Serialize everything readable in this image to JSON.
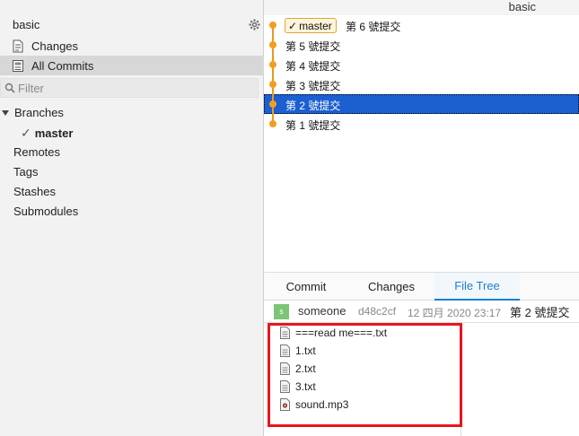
{
  "window": {
    "title": "basic"
  },
  "sidebar": {
    "repo_name": "basic",
    "settings_icon": "gear-icon",
    "nav": [
      {
        "label": "Changes",
        "icon": "changes-icon",
        "active": false
      },
      {
        "label": "All Commits",
        "icon": "commits-icon",
        "active": true
      }
    ],
    "filter": {
      "placeholder": "Filter",
      "value": ""
    },
    "tree": {
      "branches_label": "Branches",
      "current_branch": "master",
      "sections": [
        "Remotes",
        "Tags",
        "Stashes",
        "Submodules"
      ]
    }
  },
  "commits": [
    {
      "branch": "master",
      "message": "第 6 號提交",
      "selected": false
    },
    {
      "message": "第 5 號提交",
      "selected": false
    },
    {
      "message": "第 4 號提交",
      "selected": false
    },
    {
      "message": "第 3 號提交",
      "selected": false
    },
    {
      "message": "第 2 號提交",
      "selected": true
    },
    {
      "message": "第 1 號提交",
      "selected": false
    }
  ],
  "details": {
    "tabs": [
      {
        "label": "Commit",
        "active": false
      },
      {
        "label": "Changes",
        "active": false
      },
      {
        "label": "File Tree",
        "active": true
      }
    ],
    "commit": {
      "avatar_letter": "s",
      "author": "someone",
      "hash": "d48c2cf",
      "date": "12 四月 2020 23:17",
      "subject": "第 2 號提交"
    },
    "files": [
      {
        "name": "===read me===.txt",
        "icon": "text-file-icon"
      },
      {
        "name": "1.txt",
        "icon": "text-file-icon"
      },
      {
        "name": "2.txt",
        "icon": "text-file-icon"
      },
      {
        "name": "3.txt",
        "icon": "text-file-icon"
      },
      {
        "name": "sound.mp3",
        "icon": "audio-file-icon"
      }
    ]
  },
  "colors": {
    "accent": "#1a7fd4",
    "selection": "#1b5fd1",
    "graph": "#f29f1f",
    "annotation": "#e8151d"
  }
}
